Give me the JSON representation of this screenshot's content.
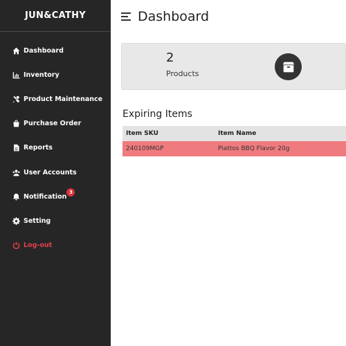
{
  "sidebar": {
    "brand": "JUN&CATHY",
    "items": [
      {
        "label": "Dashboard",
        "icon": "home-icon"
      },
      {
        "label": "Inventory",
        "icon": "chart-icon"
      },
      {
        "label": "Product Maintenance",
        "icon": "tools-icon"
      },
      {
        "label": "Purchase Order",
        "icon": "shopping-bag-icon"
      },
      {
        "label": "Reports",
        "icon": "file-icon"
      },
      {
        "label": "User Accounts",
        "icon": "users-icon"
      },
      {
        "label": "Notification",
        "icon": "bell-icon",
        "badge": "3"
      },
      {
        "label": "Setting",
        "icon": "gear-icon"
      },
      {
        "label": "Log-out",
        "icon": "power-icon"
      }
    ]
  },
  "header": {
    "title": "Dashboard"
  },
  "summary_card": {
    "count": "2",
    "label": "Products",
    "icon": "box-icon"
  },
  "expiring": {
    "title": "Expiring Items",
    "columns": [
      "Item SKU",
      "Item Name"
    ],
    "rows": [
      {
        "sku": "240109MGP",
        "name": "Piattos BBQ Flavor 20g"
      }
    ]
  },
  "colors": {
    "sidebar_bg": "#262626",
    "logout": "#e0404a",
    "badge": "#d9313b",
    "card_bg": "#e8e8e8",
    "expired_row": "#f07b7f"
  }
}
